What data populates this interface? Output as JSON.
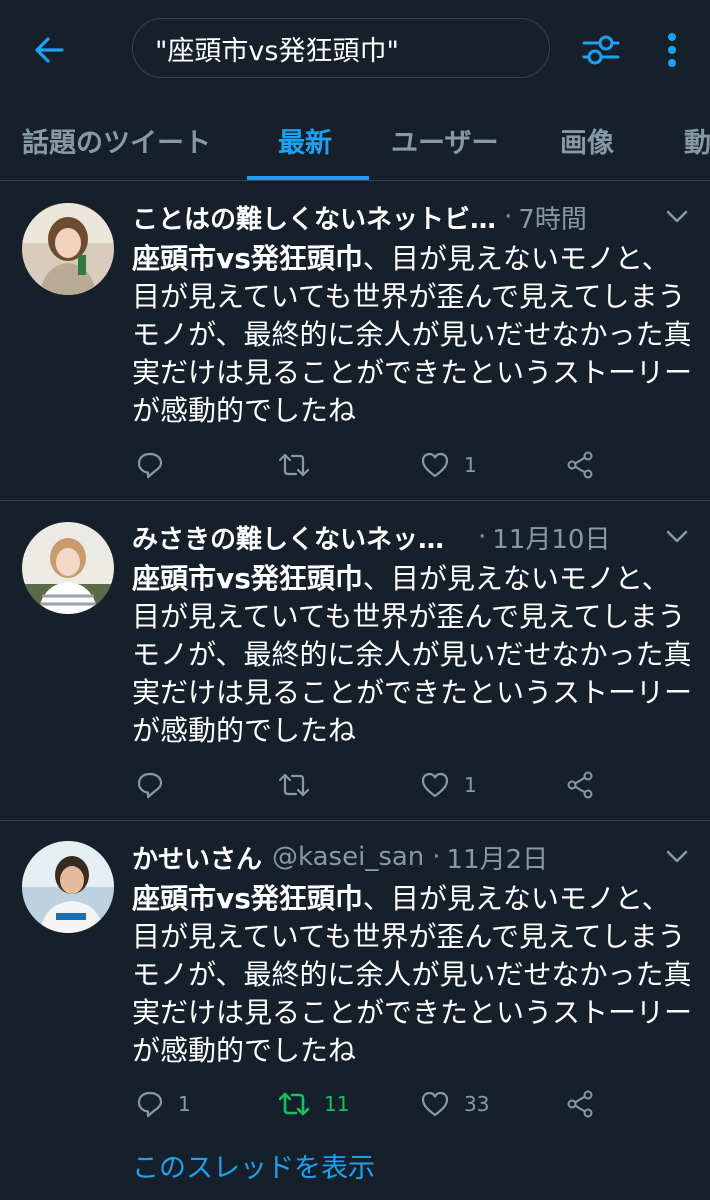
{
  "search": {
    "query": "\"座頭市vs発狂頭巾\""
  },
  "tabs": [
    {
      "label": "話題のツイート"
    },
    {
      "label": "最新"
    },
    {
      "label": "ユーザー"
    },
    {
      "label": "画像"
    },
    {
      "label": "動"
    }
  ],
  "tweets": [
    {
      "name": "ことはの難しくないネットビ…",
      "handle": "",
      "time": "7時間",
      "highlight": "座頭市vs発狂頭巾",
      "text": "、目が見えないモノと、目が見えていても世界が歪んで見えてしまうモノが、最終的に余人が見いだせなかった真実だけは見ることができたというストーリーが感動的でしたね",
      "reply_count": "",
      "retweet_count": "",
      "like_count": "1"
    },
    {
      "name": "みさきの難しくないネッ…",
      "handle": "",
      "time": "11月10日",
      "highlight": "座頭市vs発狂頭巾",
      "text": "、目が見えないモノと、目が見えていても世界が歪んで見えてしまうモノが、最終的に余人が見いだせなかった真実だけは見ることができたというストーリーが感動的でしたね",
      "reply_count": "",
      "retweet_count": "",
      "like_count": "1"
    },
    {
      "name": "かせいさん",
      "handle": "@kasei_san",
      "time": "11月2日",
      "highlight": "座頭市vs発狂頭巾",
      "text": "、目が見えないモノと、目が見えていても世界が歪んで見えてしまうモノが、最終的に余人が見いだせなかった真実だけは見ることができたというストーリーが感動的でしたね",
      "reply_count": "1",
      "retweet_count": "11",
      "like_count": "33"
    }
  ],
  "thread_link": "このスレッドを表示",
  "colors": {
    "background": "#15202b",
    "accent": "#1da1f2",
    "muted": "#8899a6",
    "retweet_active": "#17bf63",
    "divider": "#38444d"
  },
  "icons": [
    "back-arrow-icon",
    "filter-icon",
    "more-vertical-icon",
    "chevron-down-icon",
    "reply-icon",
    "retweet-icon",
    "like-icon",
    "share-icon"
  ]
}
